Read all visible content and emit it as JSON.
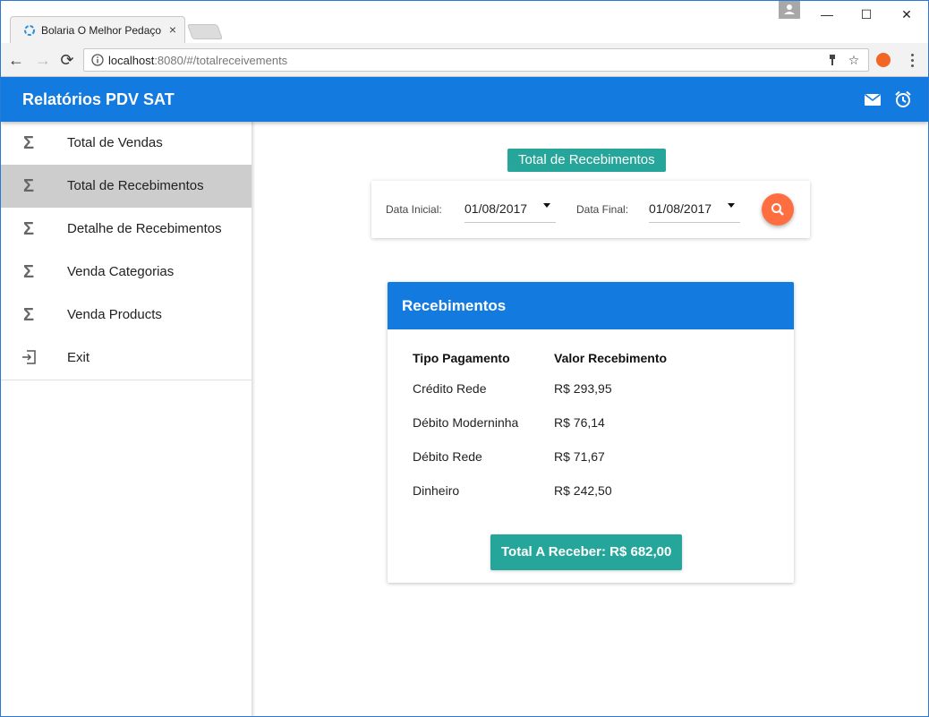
{
  "browser": {
    "tab_title": "Bolaria O Melhor Pedaço",
    "tab_close": "×",
    "url_host": "localhost",
    "url_rest": ":8080/#/totalreceivements",
    "window_minimize": "—",
    "window_maximize": "☐",
    "window_close": "✕",
    "back": "←",
    "forward": "→",
    "reload": "⟳"
  },
  "appbar": {
    "title": "Relatórios PDV SAT",
    "icons": [
      "mail-icon",
      "alarm-icon"
    ]
  },
  "sidebar": {
    "items": [
      {
        "icon": "sigma-icon",
        "glyph": "Σ",
        "label": "Total de Vendas",
        "active": false
      },
      {
        "icon": "sigma-icon",
        "glyph": "Σ",
        "label": "Total de Recebimentos",
        "active": true
      },
      {
        "icon": "sigma-icon",
        "glyph": "Σ",
        "label": "Detalhe de Recebimentos",
        "active": false
      },
      {
        "icon": "sigma-icon",
        "glyph": "Σ",
        "label": "Venda Categorias",
        "active": false
      },
      {
        "icon": "sigma-icon",
        "glyph": "Σ",
        "label": "Venda Products",
        "active": false
      },
      {
        "icon": "exit-icon",
        "glyph": "⇥",
        "label": "Exit",
        "active": false
      }
    ]
  },
  "main": {
    "page_title": "Total de Recebimentos",
    "filter": {
      "start_label": "Data Inicial:",
      "start_value": "01/08/2017",
      "end_label": "Data Final:",
      "end_value": "01/08/2017"
    },
    "card": {
      "title": "Recebimentos",
      "columns": [
        "Tipo Pagamento",
        "Valor Recebimento"
      ],
      "rows": [
        [
          "Crédito Rede",
          "R$ 293,95"
        ],
        [
          "Débito Moderninha",
          "R$ 76,14"
        ],
        [
          "Débito Rede",
          "R$ 71,67"
        ],
        [
          "Dinheiro",
          "R$ 242,50"
        ]
      ],
      "total_label": "Total A Receber: R$ 682,00"
    }
  },
  "colors": {
    "primary": "#137ae0",
    "teal": "#26a69a",
    "fab": "#ff6e40"
  }
}
